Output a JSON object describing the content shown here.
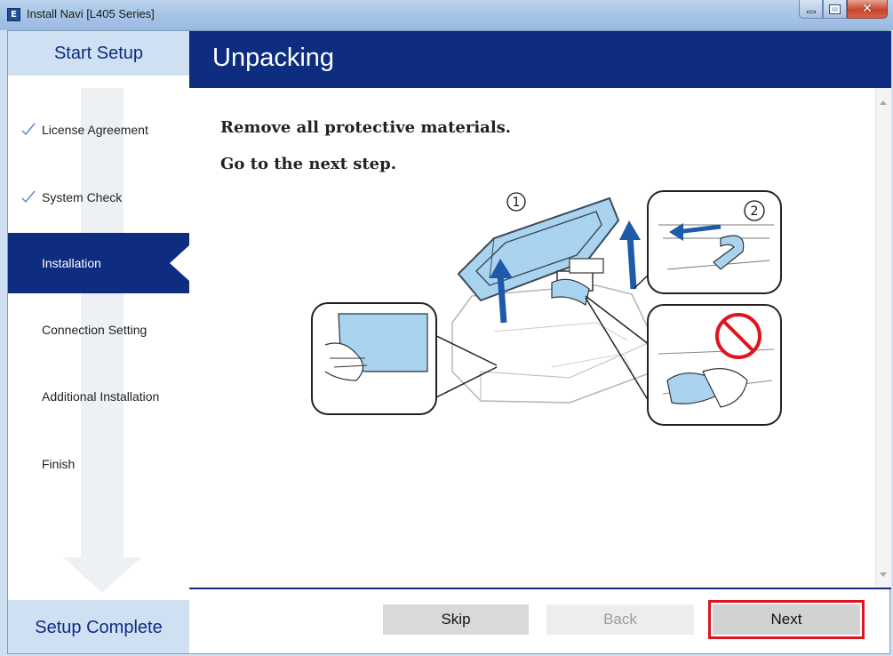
{
  "window": {
    "title": "Install Navi [L405 Series]",
    "app_icon_letter": "E"
  },
  "sidebar": {
    "header": "Start Setup",
    "footer": "Setup Complete",
    "steps": [
      {
        "label": "License Agreement",
        "status": "done"
      },
      {
        "label": "System Check",
        "status": "done"
      },
      {
        "label": "Installation",
        "status": "current"
      },
      {
        "label": "Connection Setting",
        "status": "pending"
      },
      {
        "label": "Additional Installation",
        "status": "pending"
      },
      {
        "label": "Finish",
        "status": "pending"
      }
    ]
  },
  "main": {
    "title": "Unpacking",
    "line1": "Remove all protective materials.",
    "line2": "Go to the next step.",
    "figure": {
      "label_1": "①",
      "label_2": "②"
    }
  },
  "buttons": {
    "skip": "Skip",
    "back": "Back",
    "next": "Next"
  },
  "colors": {
    "accent": "#0e2d80",
    "highlight": "#e0141e",
    "tape": "#a9d3ef"
  }
}
